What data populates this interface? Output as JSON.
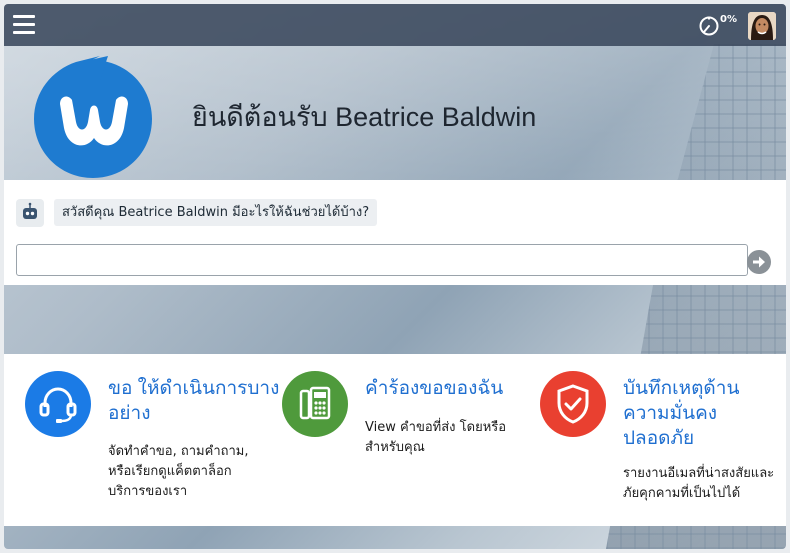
{
  "topbar": {
    "progress": "0%"
  },
  "hero": {
    "welcome": "ยินดีต้อนรับ Beatrice Baldwin"
  },
  "chat": {
    "bot_message": "สวัสดีคุณ Beatrice Baldwin มีอะไรให้ฉันช่วยได้บ้าง?",
    "input_value": "",
    "input_placeholder": ""
  },
  "cards": [
    {
      "title": "ขอ ให้ดำเนินการบางอย่าง",
      "desc": "จัดทำคำขอ, ถามคำถาม, หรือเรียกดูแค็ตตาล็อกบริการของเรา",
      "color": "#1b7be6",
      "icon": "headset-icon"
    },
    {
      "title": "คำร้องขอของฉัน",
      "desc": "View คำขอที่ส่ง โดยหรือสำหรับคุณ",
      "color": "#4f9a3c",
      "icon": "phone-icon"
    },
    {
      "title": "บันทึกเหตุด้านความมั่นคงปลอดภัย",
      "desc": "รายงานอีเมลที่น่าสงสัยและภัยคุกคามที่เป็นไปได้",
      "color": "#e94030",
      "icon": "shield-check-icon"
    }
  ]
}
